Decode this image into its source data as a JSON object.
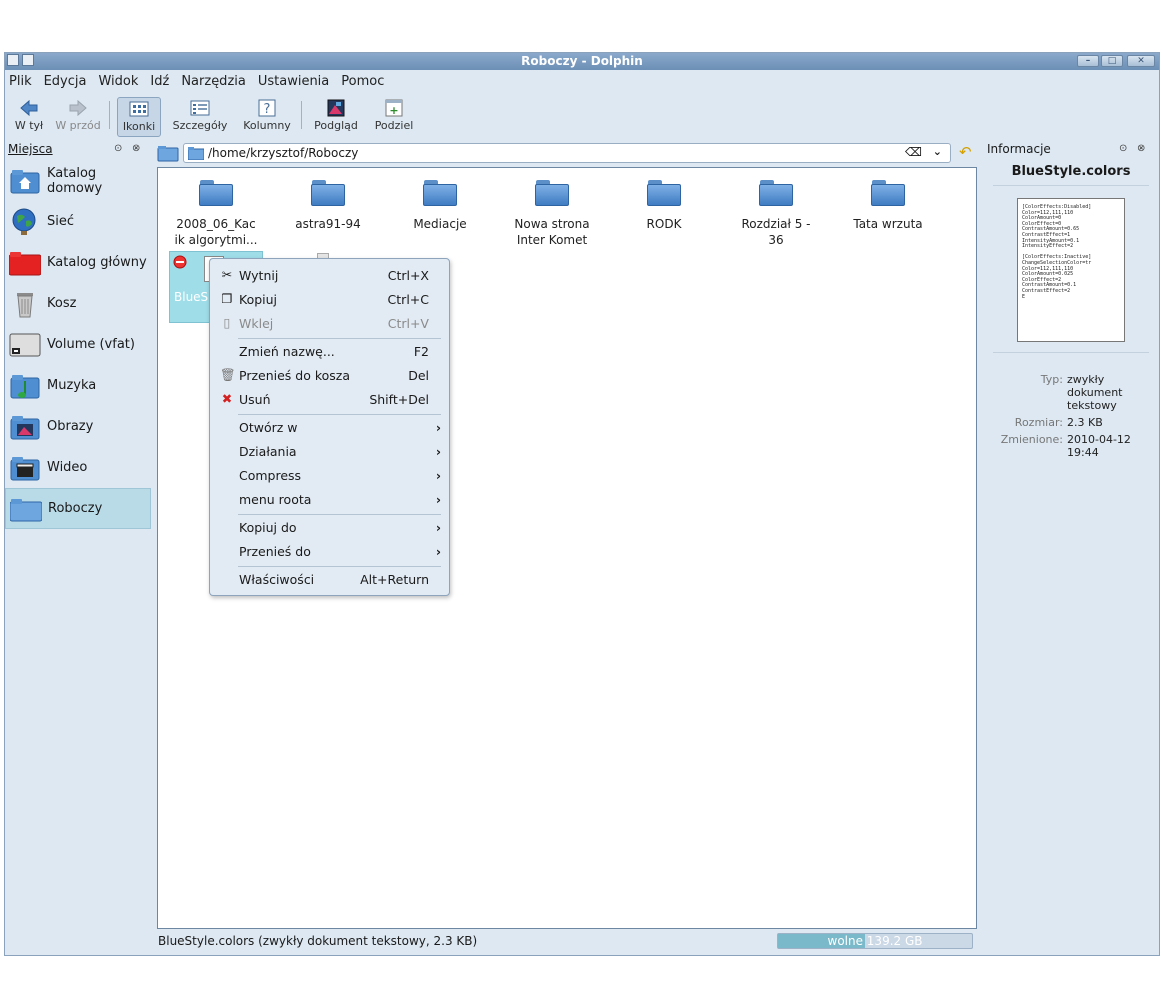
{
  "window": {
    "title": "Roboczy - Dolphin"
  },
  "menubar": [
    "Plik",
    "Edycja",
    "Widok",
    "Idź",
    "Narzędzia",
    "Ustawienia",
    "Pomoc"
  ],
  "toolbar": {
    "back": "W tył",
    "forward": "W przód",
    "icons": "Ikonki",
    "details": "Szczegóły",
    "columns": "Kolumny",
    "preview": "Podgląd",
    "split": "Podziel"
  },
  "places": {
    "title": "Miejsca",
    "items": [
      {
        "label": "Katalog domowy",
        "icon": "home-folder-icon"
      },
      {
        "label": "Sieć",
        "icon": "network-globe-icon"
      },
      {
        "label": "Katalog główny",
        "icon": "root-folder-icon"
      },
      {
        "label": "Kosz",
        "icon": "trash-icon"
      },
      {
        "label": "Volume (vfat)",
        "icon": "drive-icon"
      },
      {
        "label": "Muzyka",
        "icon": "music-folder-icon"
      },
      {
        "label": "Obrazy",
        "icon": "pictures-folder-icon"
      },
      {
        "label": "Wideo",
        "icon": "video-folder-icon"
      },
      {
        "label": "Roboczy",
        "icon": "folder-icon"
      }
    ],
    "selected": "Roboczy"
  },
  "location": {
    "path": "/home/krzysztof/Roboczy"
  },
  "files": [
    {
      "line1": "2008_06_Kac",
      "line2": "ik algorytmi..."
    },
    {
      "line1": "astra91-94",
      "line2": ""
    },
    {
      "line1": "Mediacje",
      "line2": ""
    },
    {
      "line1": "Nowa strona",
      "line2": "Inter Komet"
    },
    {
      "line1": "RODK",
      "line2": ""
    },
    {
      "line1": "Rozdział 5 -",
      "line2": "36"
    },
    {
      "line1": "Tata wrzuta",
      "line2": ""
    }
  ],
  "selected_file": {
    "label_partial": "BlueS"
  },
  "context_menu": {
    "cut": {
      "label": "Wytnij",
      "shortcut": "Ctrl+X"
    },
    "copy": {
      "label": "Kopiuj",
      "shortcut": "Ctrl+C"
    },
    "paste": {
      "label": "Wklej",
      "shortcut": "Ctrl+V"
    },
    "rename": {
      "label": "Zmień nazwę...",
      "shortcut": "F2"
    },
    "trash": {
      "label": "Przenieś do kosza",
      "shortcut": "Del"
    },
    "delete": {
      "label": "Usuń",
      "shortcut": "Shift+Del"
    },
    "open_with": "Otwórz w",
    "actions": "Działania",
    "compress": "Compress",
    "root_menu": "menu roota",
    "copy_to": "Kopiuj do",
    "move_to": "Przenieś do",
    "properties": {
      "label": "Właściwości",
      "shortcut": "Alt+Return"
    }
  },
  "status": {
    "text": "BlueStyle.colors (zwykły dokument tekstowy, 2.3 KB)",
    "free": "wolne 139.2 GB",
    "used_fraction": 0.45
  },
  "info_panel": {
    "title": "Informacje",
    "filename": "BlueStyle.colors",
    "preview_lines": [
      "[ColorEffects:Disabled]",
      "Color=112,111,110",
      "ColorAmount=0",
      "ColorEffect=0",
      "ContrastAmount=0.65",
      "ContrastEffect=1",
      "IntensityAmount=0.1",
      "IntensityEffect=2",
      "",
      "[ColorEffects:Inactive]",
      "ChangeSelectionColor=tr",
      "Color=112,111,110",
      "ColorAmount=0.025",
      "ColorEffect=2",
      "ContrastAmount=0.1",
      "ContrastEffect=2",
      "E"
    ],
    "type_label": "Typ:",
    "type_value": "zwykły dokument tekstowy",
    "size_label": "Rozmiar:",
    "size_value": "2.3 KB",
    "modified_label": "Zmienione:",
    "modified_value": "2010-04-12 19:44"
  }
}
